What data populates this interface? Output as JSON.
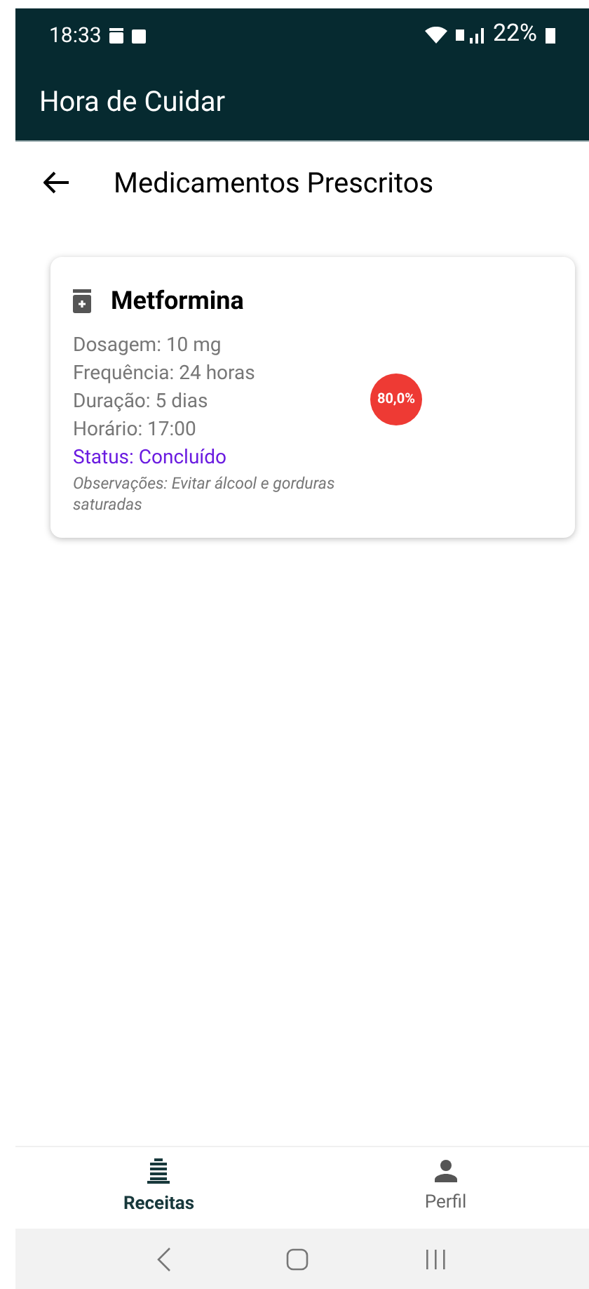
{
  "status_bar": {
    "time": "18:33",
    "battery": "22%"
  },
  "app_bar": {
    "title": "Hora de Cuidar"
  },
  "header": {
    "title": "Medicamentos Prescritos"
  },
  "medications": [
    {
      "name": "Metformina",
      "details": [
        "Dosagem: 10 mg",
        "Frequência: 24 horas",
        "Duração: 5 dias",
        "Horário: 17:00"
      ],
      "status": "Status: Concluído",
      "notes": "Observações: Evitar álcool e gorduras saturadas",
      "progress": "80,0%"
    }
  ],
  "bottom_nav": [
    {
      "label": "Receitas",
      "kind": "list",
      "selected": true
    },
    {
      "label": "Perfil",
      "kind": "person",
      "selected": false
    }
  ]
}
